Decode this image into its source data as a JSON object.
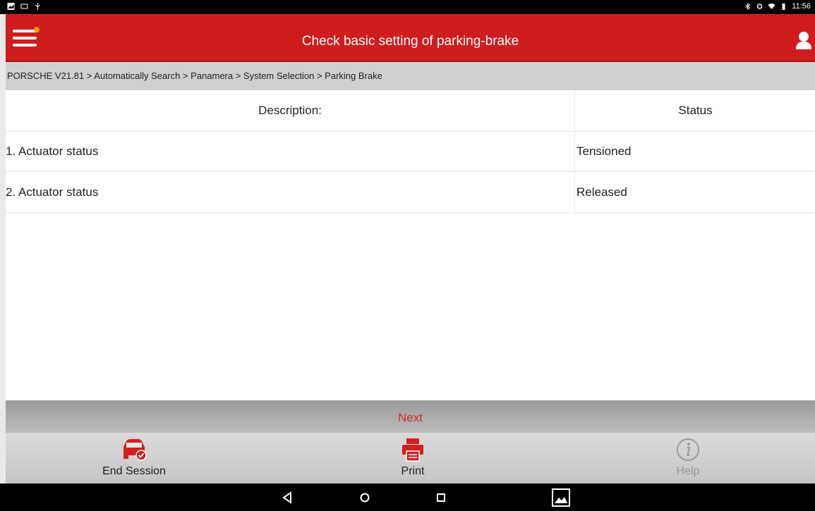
{
  "status_bar": {
    "time": "11:56"
  },
  "header": {
    "title": "Check basic setting of parking-brake"
  },
  "breadcrumb": {
    "text": "PORSCHE V21.81 > Automatically Search > Panamera > System Selection > Parking Brake"
  },
  "table": {
    "headers": [
      "Description:",
      "Status"
    ],
    "rows": [
      {
        "description": "1. Actuator status",
        "status": "Tensioned"
      },
      {
        "description": "2. Actuator status",
        "status": "Released"
      }
    ]
  },
  "actions": {
    "next_label": "Next"
  },
  "toolbar": {
    "end_session_label": "End Session",
    "print_label": "Print",
    "help_label": "Help"
  },
  "colors": {
    "brand": "#cf1d1d",
    "next_text": "#d12b2b"
  }
}
